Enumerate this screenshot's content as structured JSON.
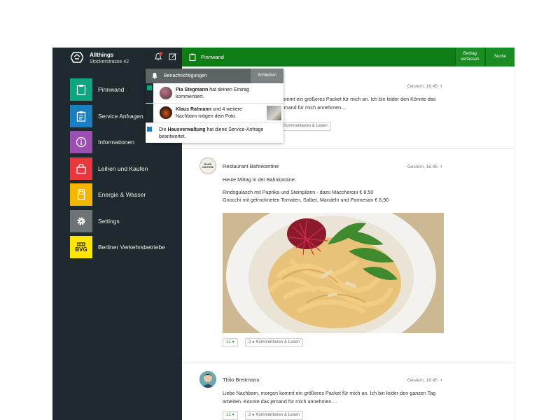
{
  "brand": {
    "name": "Allthings",
    "address": "Stockerstrasse 42"
  },
  "sidebar": {
    "items": [
      {
        "label": "Pinnwand",
        "color": "#0fa37f",
        "icon": "clipboard-icon"
      },
      {
        "label": "Service Anfragen",
        "color": "#1a7fbf",
        "icon": "checklist-icon"
      },
      {
        "label": "Informationen",
        "color": "#9c4fb0",
        "icon": "info-icon"
      },
      {
        "label": "Leihen und Kaufen",
        "color": "#e8373f",
        "icon": "shopping-bag-icon"
      },
      {
        "label": "Energie & Wasser",
        "color": "#f4b400",
        "icon": "meter-icon"
      },
      {
        "label": "Settings",
        "color": "#6e7476",
        "icon": "gear-icon"
      },
      {
        "label": "Berliner Verkehrsbetriebe",
        "color": "#ffe500",
        "icon": "bvg-logo",
        "tile_text": "BVG"
      }
    ]
  },
  "topbar": {
    "title": "Pinnwand",
    "write_label_line1": "Beitrag",
    "write_label_line2": "verfassen",
    "search_label": "Suche"
  },
  "notifications": {
    "title": "Benachrichtigungen",
    "close_label": "Schließen",
    "items": [
      {
        "name": "Pia Stegmann",
        "text": " hat deinen Eintrag kommentiert."
      },
      {
        "name": "Klaus Ratmann",
        "text": " und 4 weitere Nachbarn mögen dein Foto."
      },
      {
        "prefix": "Die ",
        "name": "Hausverwaltung",
        "text": " hat diene Service-Anfrage beantwortet."
      }
    ]
  },
  "feed": {
    "posts": [
      {
        "author": "",
        "time": "Gestern, 16:45",
        "text": "kommt ein größeres Packet für mich an. Ich bin leider den Könnte das jemand  für mich annehmen....",
        "comments_label": "Kommentieren & Lesen"
      },
      {
        "author": "Restaurant Bahnkantine",
        "time": "Gestern, 16:45",
        "line1": "Heute Mittag in der Bahnkantine:",
        "line2": "Rindsgulasch mit Paprika und Steinpilzen - dazu Maccheroni € 8,50",
        "line3": "Gnocchi mit getrockneten Tomaten, Salbei, Mandeln und Parmesan € 6,90",
        "likes": "12",
        "comments": "2",
        "comments_label": "Kommentieren & Lesen",
        "avatar_text": "BAHN KANTINE"
      },
      {
        "author": "Thilo Breitmann",
        "time": "Gestern, 16:45",
        "text": "Liebe Nachbarn, morgen kommt ein größeres Packet für mich an. Ich bin leider den ganzen Tag arbeiten. Könnte das jemand  für mich annehmen....",
        "likes": "12",
        "comments": "2",
        "comments_label": "Kommentieren & Lesen"
      }
    ]
  }
}
